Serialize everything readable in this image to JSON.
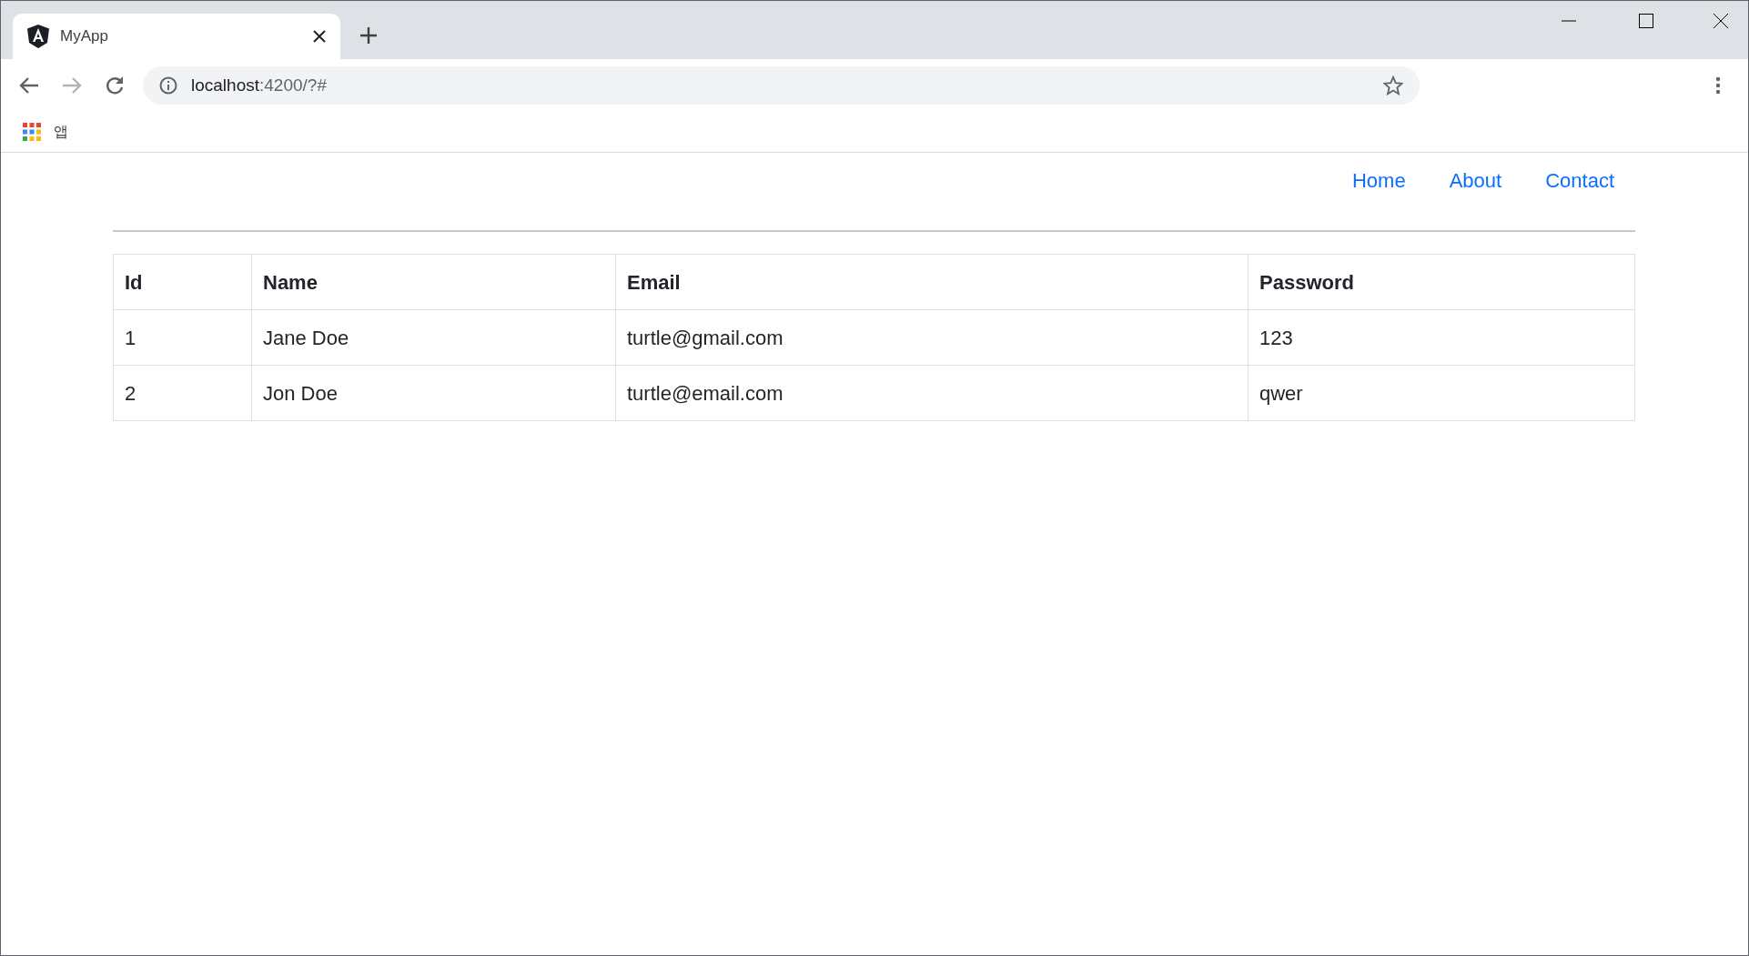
{
  "browser": {
    "tab": {
      "title": "MyApp"
    },
    "address": {
      "host": "localhost",
      "rest": ":4200/?#"
    },
    "bookmarks": [
      {
        "label": "앱"
      }
    ]
  },
  "nav": [
    {
      "label": "Home"
    },
    {
      "label": "About"
    },
    {
      "label": "Contact"
    }
  ],
  "table": {
    "columns": [
      "Id",
      "Name",
      "Email",
      "Password"
    ],
    "rows": [
      [
        "1",
        "Jane Doe",
        "turtle@gmail.com",
        "123"
      ],
      [
        "2",
        "Jon Doe",
        "turtle@email.com",
        "qwer"
      ]
    ]
  }
}
